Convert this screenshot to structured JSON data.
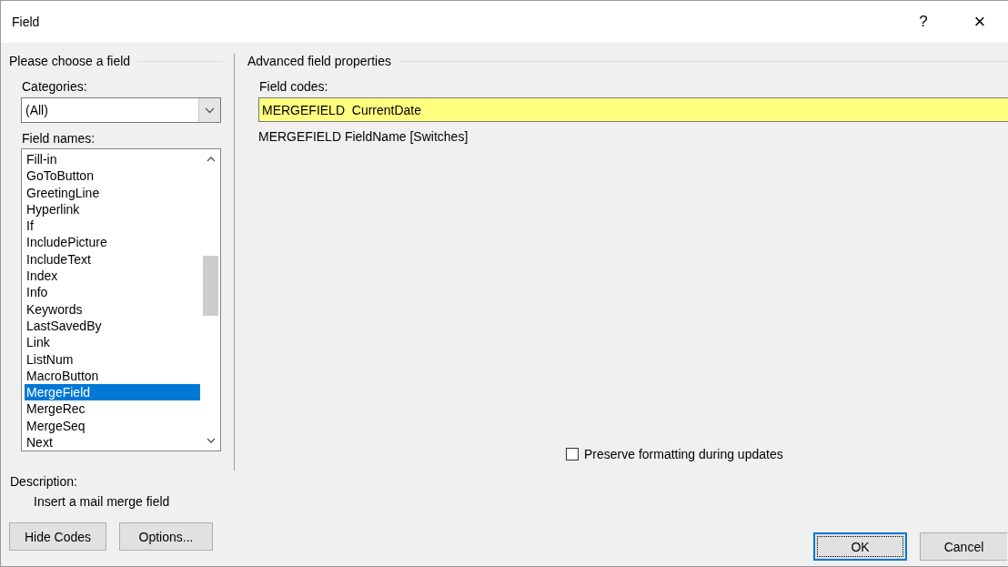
{
  "window": {
    "title": "Field",
    "help_button": "?",
    "close_button": "×"
  },
  "left_panel": {
    "heading": "Please choose a field",
    "categories_label": "Categories:",
    "categories_value": "(All)",
    "field_names_label": "Field names:",
    "field_names": [
      {
        "label": "Fill-in",
        "selected": false
      },
      {
        "label": "GoToButton",
        "selected": false
      },
      {
        "label": "GreetingLine",
        "selected": false
      },
      {
        "label": "Hyperlink",
        "selected": false
      },
      {
        "label": "If",
        "selected": false
      },
      {
        "label": "IncludePicture",
        "selected": false
      },
      {
        "label": "IncludeText",
        "selected": false
      },
      {
        "label": "Index",
        "selected": false
      },
      {
        "label": "Info",
        "selected": false
      },
      {
        "label": "Keywords",
        "selected": false
      },
      {
        "label": "LastSavedBy",
        "selected": false
      },
      {
        "label": "Link",
        "selected": false
      },
      {
        "label": "ListNum",
        "selected": false
      },
      {
        "label": "MacroButton",
        "selected": false
      },
      {
        "label": "MergeField",
        "selected": true
      },
      {
        "label": "MergeRec",
        "selected": false
      },
      {
        "label": "MergeSeq",
        "selected": false
      },
      {
        "label": "Next",
        "selected": false
      }
    ],
    "description_label": "Description:",
    "description": "Insert a mail merge field"
  },
  "right_panel": {
    "heading": "Advanced field properties",
    "field_codes_label": "Field codes:",
    "field_codes_value": "MERGEFIELD  CurrentDate",
    "syntax": "MERGEFIELD FieldName [Switches]",
    "preserve_formatting": {
      "label": "Preserve formatting during updates",
      "checked": false
    }
  },
  "left_buttons": [
    {
      "label": "Hide Codes",
      "default": false
    },
    {
      "label": "Options...",
      "default": false
    }
  ],
  "right_buttons": [
    {
      "label": "OK",
      "default": true
    },
    {
      "label": "Cancel",
      "default": false
    }
  ]
}
